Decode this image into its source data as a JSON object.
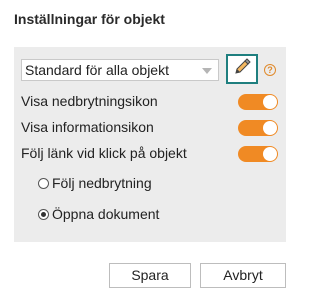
{
  "dialog": {
    "title": "Inställningar för objekt"
  },
  "select": {
    "value": "Standard för alla objekt"
  },
  "icons": {
    "edit": "pencil-icon",
    "help": "help-icon",
    "help_glyph": "?"
  },
  "options": [
    {
      "label": "Visa nedbrytningsikon",
      "enabled": true
    },
    {
      "label": "Visa informationsikon",
      "enabled": true
    },
    {
      "label": "Följ länk vid klick på objekt",
      "enabled": true
    }
  ],
  "radio": [
    {
      "label": "Följ nedbrytning",
      "selected": false
    },
    {
      "label": "Öppna dokument",
      "selected": true
    }
  ],
  "buttons": {
    "save": "Spara",
    "cancel": "Avbryt"
  },
  "colors": {
    "accent": "#f08a24",
    "edit_border": "#1f7f7f",
    "panel": "#ececec"
  }
}
